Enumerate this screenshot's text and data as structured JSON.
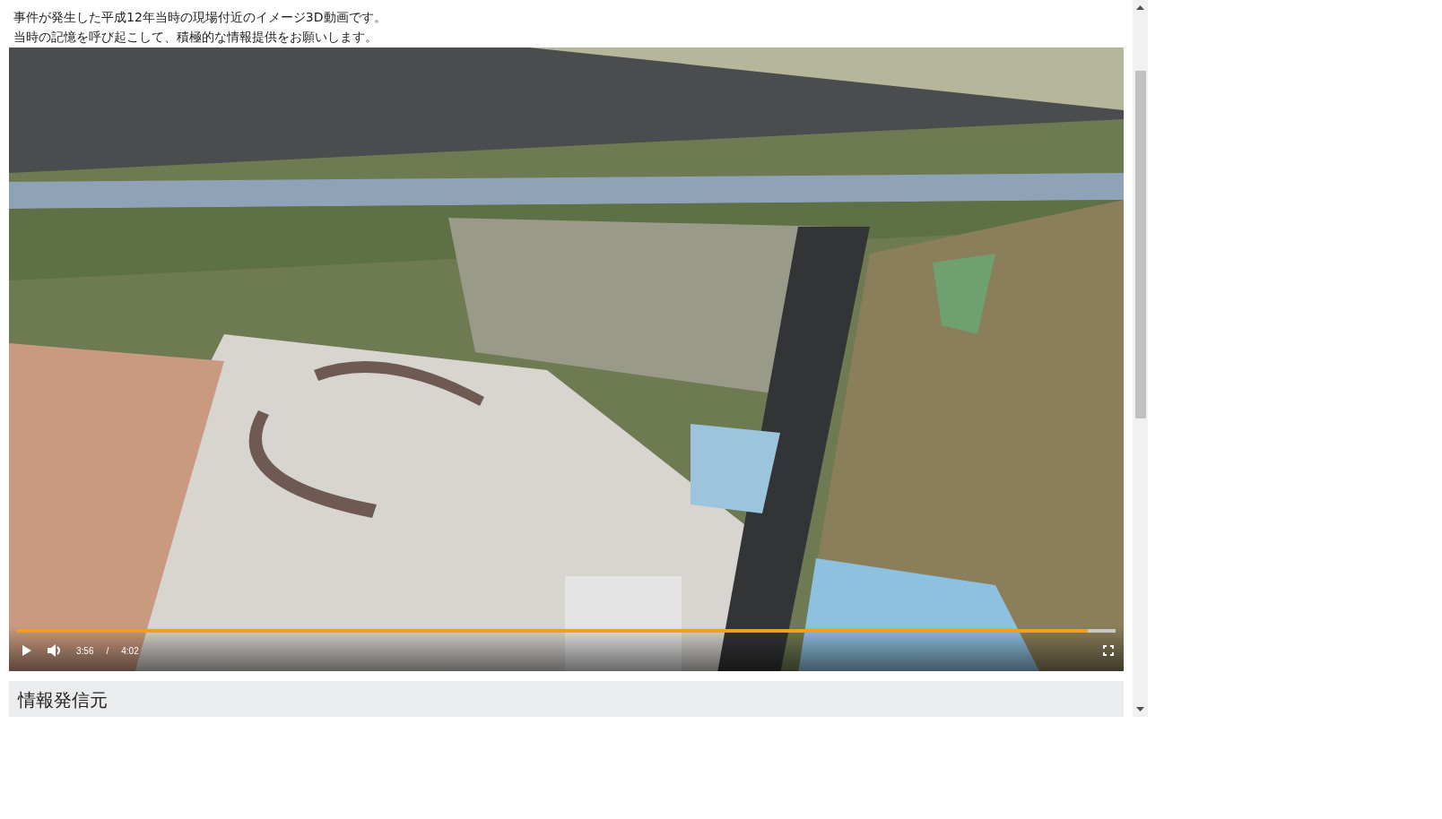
{
  "intro": [
    "事件が発生した平成12年当時の現場付近のイメージ3D動画です。",
    "当時の記憶を呼び起こして、積極的な情報提供をお願いします。"
  ],
  "video": {
    "kind": "picture",
    "progress": {
      "level": 0.975
    },
    "current_time": "3:56",
    "separator": "/",
    "duration": "4:02"
  },
  "section": {
    "heading": "情報発信元"
  }
}
